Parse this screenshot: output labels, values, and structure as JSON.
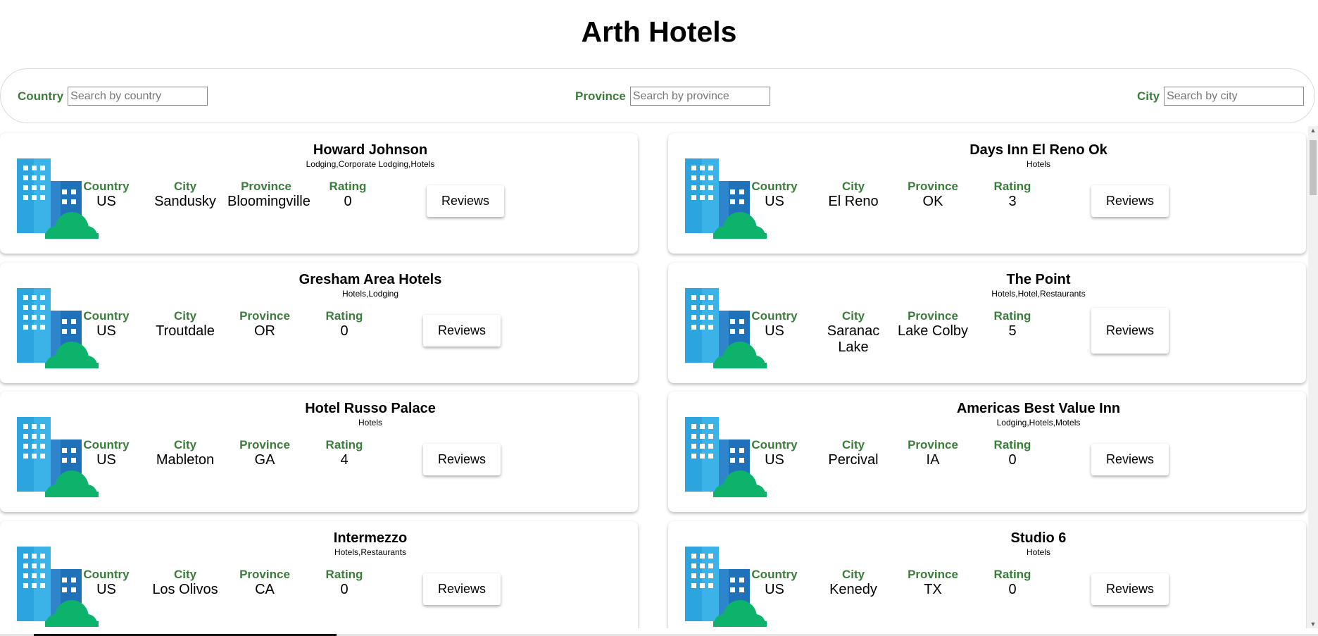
{
  "title": "Arth Hotels",
  "search": {
    "country_label": "Country",
    "country_placeholder": "Search by country",
    "province_label": "Province",
    "province_placeholder": "Search by province",
    "city_label": "City",
    "city_placeholder": "Search by city"
  },
  "field_labels": {
    "country": "Country",
    "city": "City",
    "province": "Province",
    "rating": "Rating"
  },
  "reviews_label": "Reviews",
  "icon": "hotel-building-icon",
  "colors": {
    "label_green": "#3a7d3a",
    "building_light": "#2ca5de",
    "building_dark": "#1f72b9",
    "bush": "#0db36b"
  },
  "hotels": [
    {
      "name": "Howard Johnson",
      "categories": "Lodging,Corporate Lodging,Hotels",
      "country": "US",
      "city": "Sandusky",
      "province": "Bloomingville",
      "rating": "0"
    },
    {
      "name": "Days Inn El Reno Ok",
      "categories": "Hotels",
      "country": "US",
      "city": "El Reno",
      "province": "OK",
      "rating": "3"
    },
    {
      "name": "Gresham Area Hotels",
      "categories": "Hotels,Lodging",
      "country": "US",
      "city": "Troutdale",
      "province": "OR",
      "rating": "0"
    },
    {
      "name": "The Point",
      "categories": "Hotels,Hotel,Restaurants",
      "country": "US",
      "city": "Saranac Lake",
      "province": "Lake Colby",
      "rating": "5"
    },
    {
      "name": "Hotel Russo Palace",
      "categories": "Hotels",
      "country": "US",
      "city": "Mableton",
      "province": "GA",
      "rating": "4"
    },
    {
      "name": "Americas Best Value Inn",
      "categories": "Lodging,Hotels,Motels",
      "country": "US",
      "city": "Percival",
      "province": "IA",
      "rating": "0"
    },
    {
      "name": "Intermezzo",
      "categories": "Hotels,Restaurants",
      "country": "US",
      "city": "Los Olivos",
      "province": "CA",
      "rating": "0"
    },
    {
      "name": "Studio 6",
      "categories": "Hotels",
      "country": "US",
      "city": "Kenedy",
      "province": "TX",
      "rating": "0"
    }
  ]
}
